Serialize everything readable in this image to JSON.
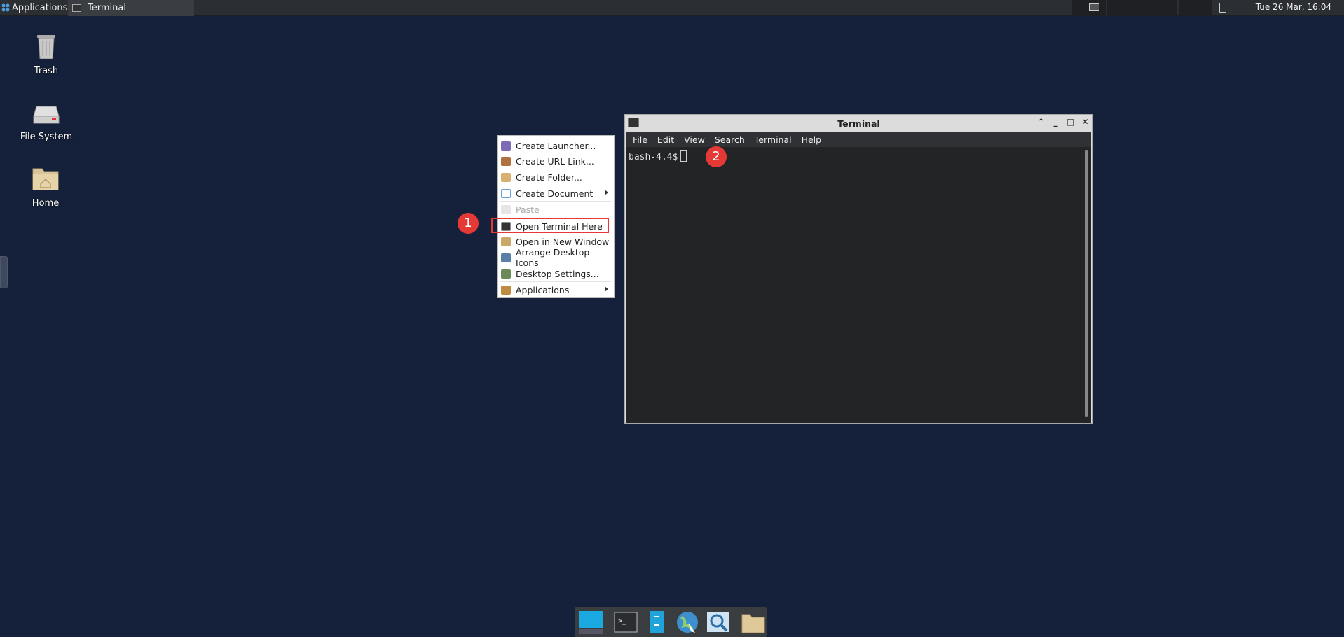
{
  "top_panel": {
    "applications_label": "Applications",
    "task_label": "Terminal",
    "clock": "Tue 26 Mar, 16:04"
  },
  "desktop_icons": [
    {
      "label": "Trash",
      "icon": "trash-icon"
    },
    {
      "label": "File System",
      "icon": "drive-icon"
    },
    {
      "label": "Home",
      "icon": "home-folder-icon"
    }
  ],
  "context_menu": {
    "items": [
      {
        "label": "Create Launcher...",
        "icon": "launcher-icon",
        "color": "#7e6bb8"
      },
      {
        "label": "Create URL Link...",
        "icon": "url-link-icon",
        "color": "#b07040"
      },
      {
        "label": "Create Folder...",
        "icon": "folder-add-icon",
        "color": "#d8b070"
      },
      {
        "label": "Create Document",
        "icon": "document-icon",
        "color": "#6aa0d8",
        "submenu": true
      },
      {
        "label": "Paste",
        "icon": "paste-icon",
        "color": "#dddddd",
        "disabled": true
      },
      {
        "label": "Open Terminal Here",
        "icon": "terminal-icon",
        "color": "#333333"
      },
      {
        "label": "Open in New Window",
        "icon": "window-icon",
        "color": "#c9a86a"
      },
      {
        "label": "Arrange Desktop Icons",
        "icon": "arrange-icon",
        "color": "#5a7fa8"
      },
      {
        "label": "Desktop Settings...",
        "icon": "settings-icon",
        "color": "#6a8a5a"
      },
      {
        "label": "Applications",
        "icon": "applications-icon",
        "color": "#c08a40",
        "submenu": true
      }
    ]
  },
  "annotations": {
    "badge1": "1",
    "badge2": "2"
  },
  "terminal": {
    "title": "Terminal",
    "menu": [
      "File",
      "Edit",
      "View",
      "Search",
      "Terminal",
      "Help"
    ],
    "prompt": "bash-4.4$"
  },
  "dock": {
    "items": [
      "show-desktop-icon",
      "terminal-icon",
      "file-manager-icon",
      "browser-icon",
      "search-icon",
      "folder-icon"
    ]
  },
  "colors": {
    "desktop_bg": "#15213a",
    "accent_red": "#e53935"
  }
}
